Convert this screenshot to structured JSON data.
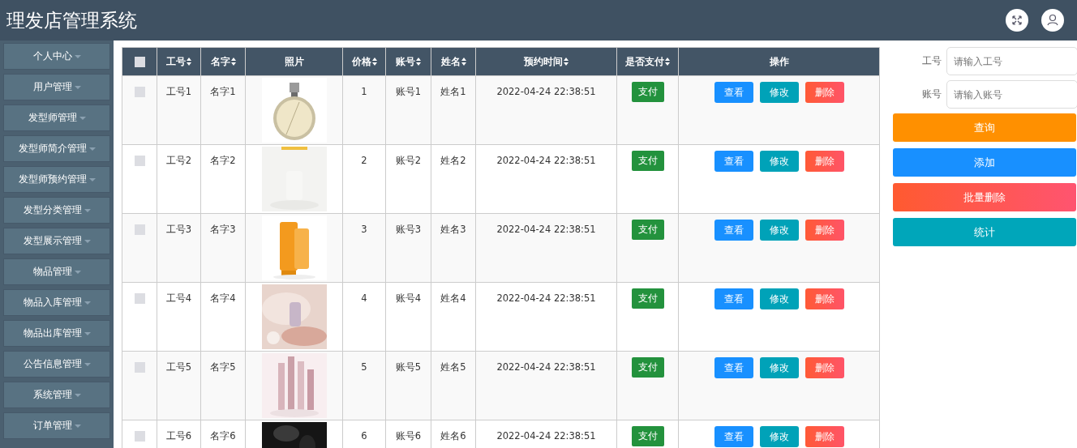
{
  "header": {
    "title": "理发店管理系统"
  },
  "sidebar": {
    "items": [
      {
        "label": "个人中心"
      },
      {
        "label": "用户管理"
      },
      {
        "label": "发型师管理"
      },
      {
        "label": "发型师简介管理"
      },
      {
        "label": "发型师预约管理"
      },
      {
        "label": "发型分类管理"
      },
      {
        "label": "发型展示管理"
      },
      {
        "label": "物品管理"
      },
      {
        "label": "物品入库管理"
      },
      {
        "label": "物品出库管理"
      },
      {
        "label": "公告信息管理"
      },
      {
        "label": "系统管理"
      },
      {
        "label": "订单管理"
      }
    ]
  },
  "table": {
    "select_all": {
      "checked": false
    },
    "columns": [
      {
        "label": "工号",
        "sortable": true
      },
      {
        "label": "名字",
        "sortable": true
      },
      {
        "label": "照片",
        "sortable": false
      },
      {
        "label": "价格",
        "sortable": true
      },
      {
        "label": "账号",
        "sortable": true
      },
      {
        "label": "姓名",
        "sortable": true
      },
      {
        "label": "预约时间",
        "sortable": true
      },
      {
        "label": "是否支付",
        "sortable": true
      },
      {
        "label": "操作",
        "sortable": false
      }
    ],
    "rows": [
      {
        "checked": false,
        "id": "工号1",
        "name": "名字1",
        "photo": {
          "kind": "picture"
        },
        "price": "1",
        "account": "账号1",
        "real_name": "姓名1",
        "time": "2022-04-24 22:38:51",
        "paid": "支付",
        "actions": [
          "查看",
          "修改",
          "删除"
        ]
      },
      {
        "checked": false,
        "id": "工号2",
        "name": "名字2",
        "photo": {
          "kind": "picture"
        },
        "price": "2",
        "account": "账号2",
        "real_name": "姓名2",
        "time": "2022-04-24 22:38:51",
        "paid": "支付",
        "actions": [
          "查看",
          "修改",
          "删除"
        ]
      },
      {
        "checked": false,
        "id": "工号3",
        "name": "名字3",
        "photo": {
          "kind": "picture"
        },
        "price": "3",
        "account": "账号3",
        "real_name": "姓名3",
        "time": "2022-04-24 22:38:51",
        "paid": "支付",
        "actions": [
          "查看",
          "修改",
          "删除"
        ]
      },
      {
        "checked": false,
        "id": "工号4",
        "name": "名字4",
        "photo": {
          "kind": "picture"
        },
        "price": "4",
        "account": "账号4",
        "real_name": "姓名4",
        "time": "2022-04-24 22:38:51",
        "paid": "支付",
        "actions": [
          "查看",
          "修改",
          "删除"
        ]
      },
      {
        "checked": false,
        "id": "工号5",
        "name": "名字5",
        "photo": {
          "kind": "picture"
        },
        "price": "5",
        "account": "账号5",
        "real_name": "姓名5",
        "time": "2022-04-24 22:38:51",
        "paid": "支付",
        "actions": [
          "查看",
          "修改",
          "删除"
        ]
      },
      {
        "checked": false,
        "id": "工号6",
        "name": "名字6",
        "photo": {
          "kind": "picture"
        },
        "price": "6",
        "account": "账号6",
        "real_name": "姓名6",
        "time": "2022-04-24 22:38:51",
        "paid": "支付",
        "actions": [
          "查看",
          "修改",
          "删除"
        ]
      }
    ]
  },
  "search": {
    "fields": [
      {
        "label": "工号",
        "placeholder": "请输入工号"
      },
      {
        "label": "账号",
        "placeholder": "请输入账号"
      }
    ],
    "buttons": [
      {
        "label": "查询",
        "kind": "query"
      },
      {
        "label": "添加",
        "kind": "add"
      },
      {
        "label": "批量删除",
        "kind": "delete"
      },
      {
        "label": "统计",
        "kind": "stats"
      }
    ]
  }
}
